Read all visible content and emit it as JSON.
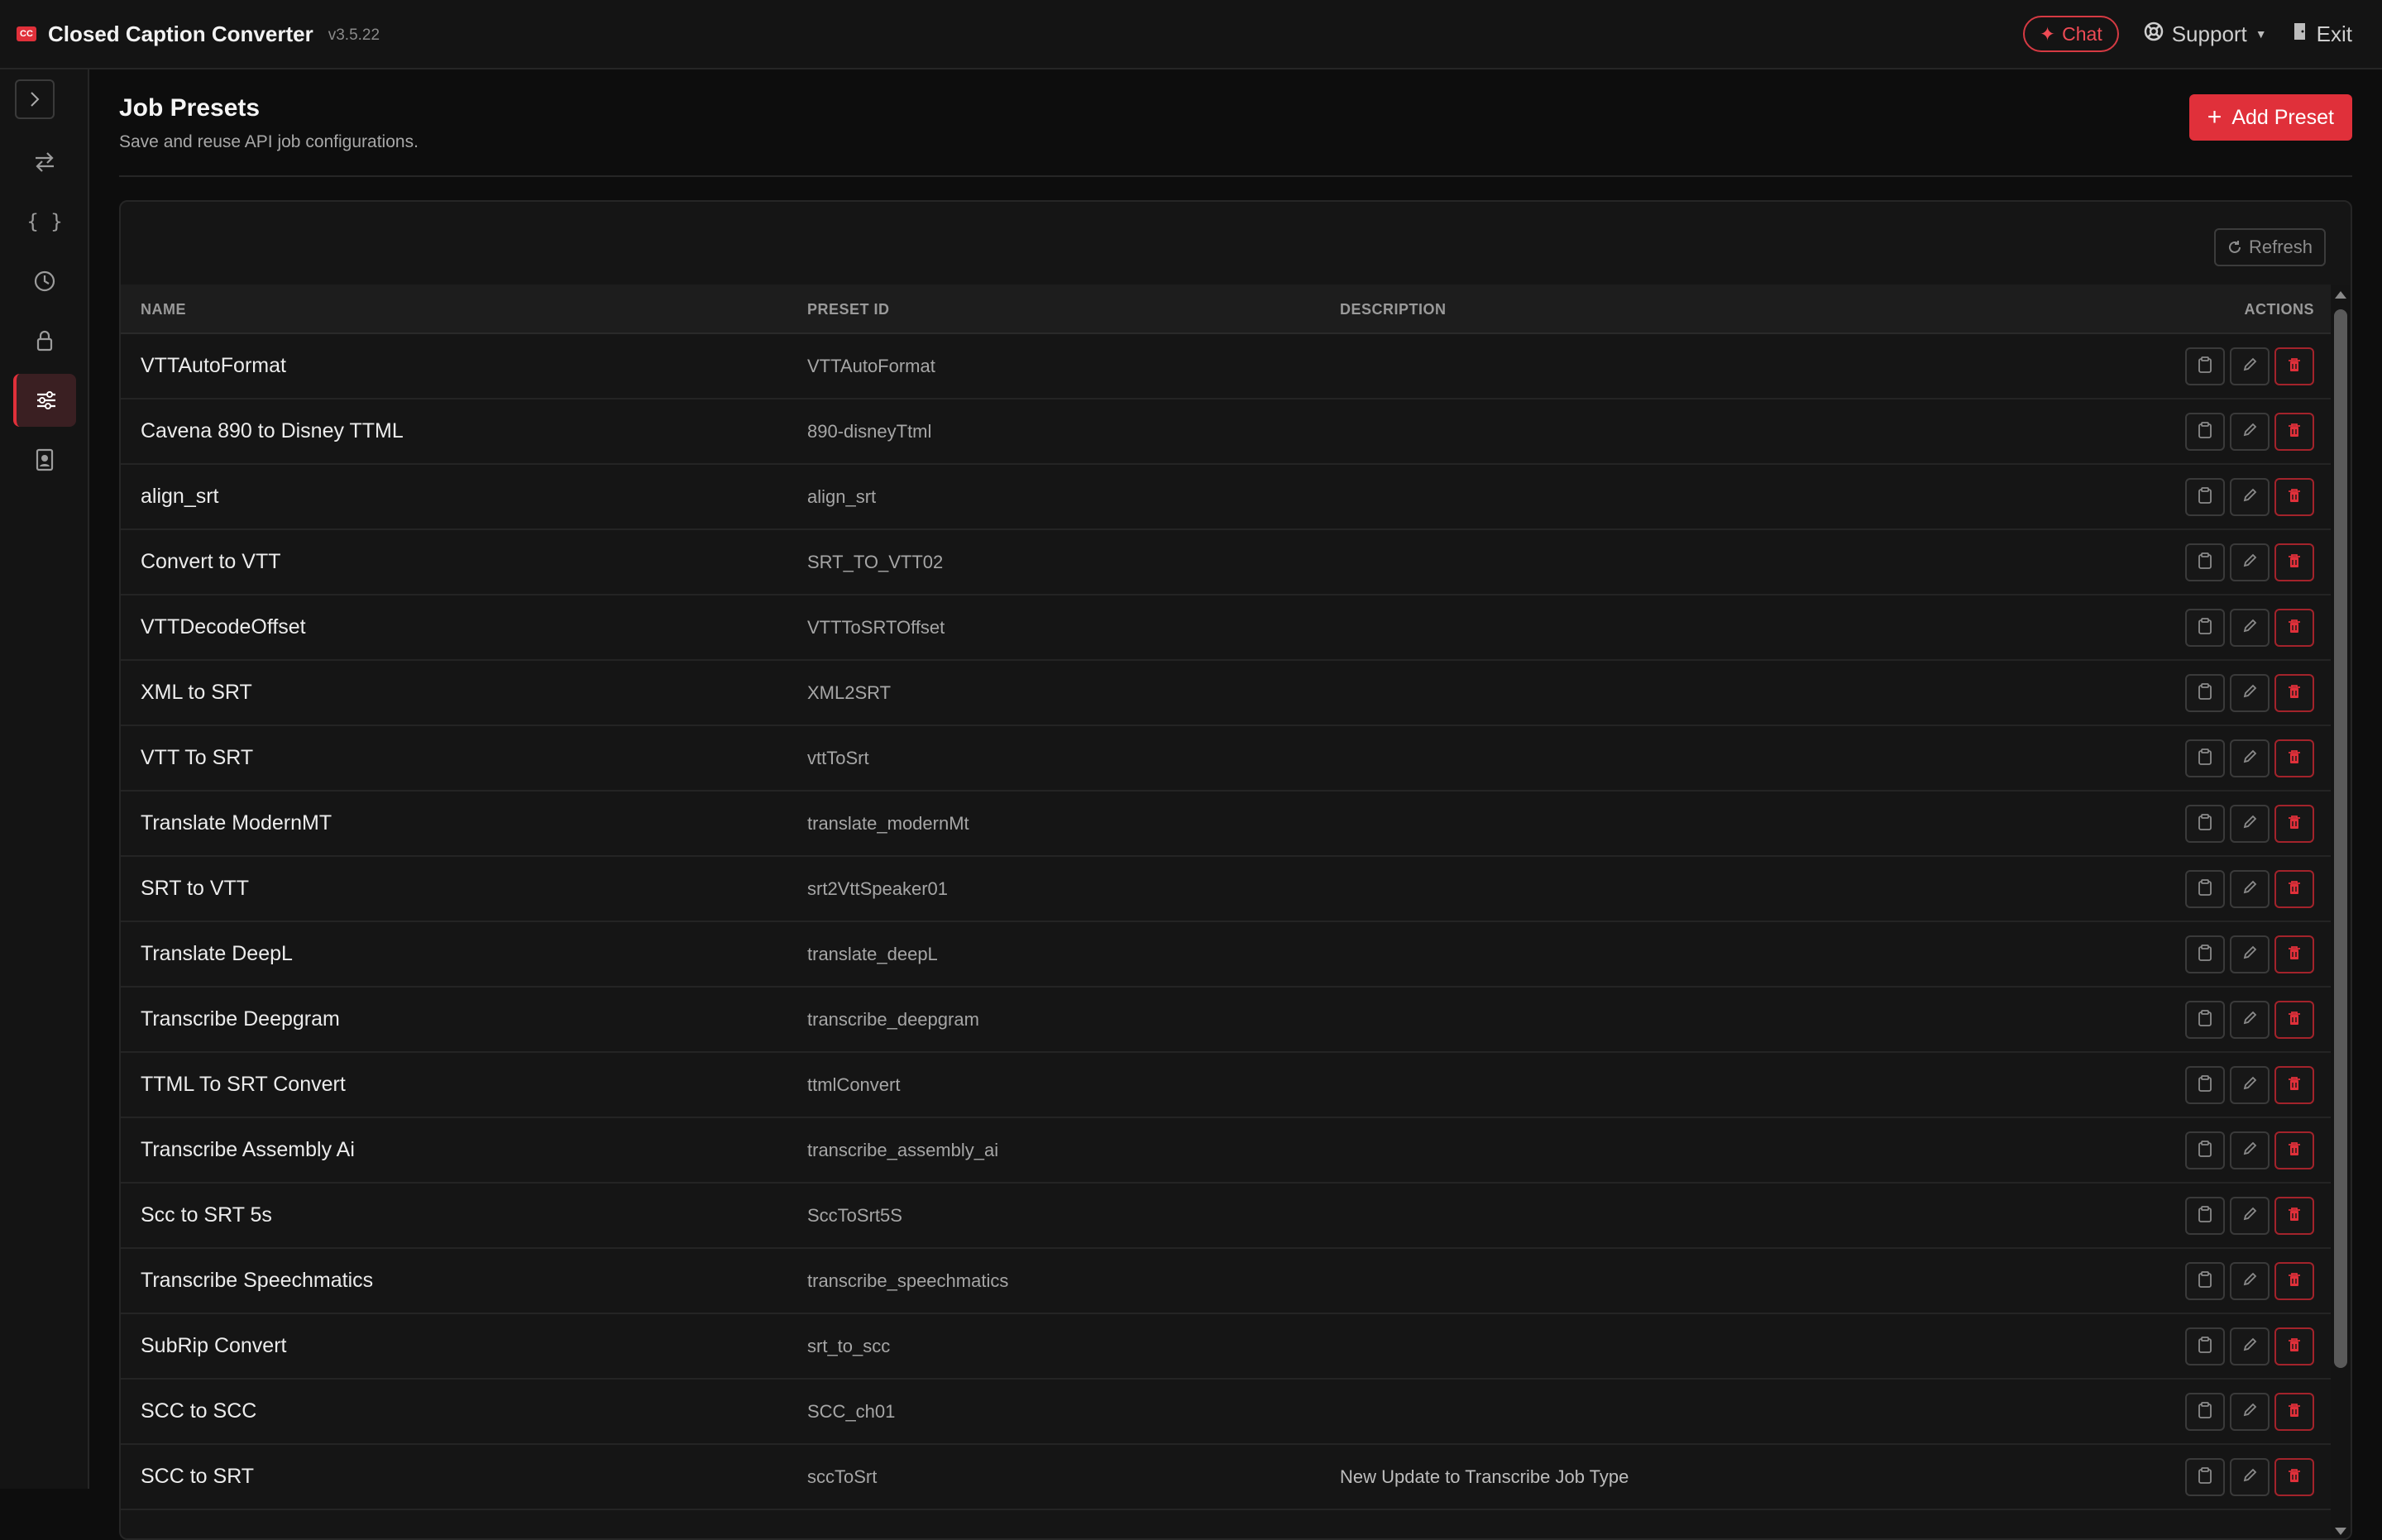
{
  "app": {
    "logo_text": "CC",
    "title": "Closed Caption Converter",
    "version": "v3.5.22",
    "chat_label": "Chat",
    "support_label": "Support",
    "exit_label": "Exit"
  },
  "sidebar": {
    "items": [
      {
        "name": "convert-icon"
      },
      {
        "name": "json-braces-icon"
      },
      {
        "name": "history-clock-icon"
      },
      {
        "name": "lock-icon"
      },
      {
        "name": "presets-sliders-icon",
        "active": true
      },
      {
        "name": "profile-badge-icon"
      }
    ]
  },
  "page": {
    "title": "Job Presets",
    "subtitle": "Save and reuse API job configurations.",
    "add_button": "Add Preset",
    "refresh_button": "Refresh"
  },
  "table": {
    "columns": {
      "name": "NAME",
      "preset_id": "PRESET ID",
      "description": "DESCRIPTION",
      "actions": "ACTIONS"
    },
    "rows": [
      {
        "name": "VTTAutoFormat",
        "id": "VTTAutoFormat",
        "desc": ""
      },
      {
        "name": "Cavena 890 to Disney TTML",
        "id": "890-disneyTtml",
        "desc": ""
      },
      {
        "name": "align_srt",
        "id": "align_srt",
        "desc": ""
      },
      {
        "name": "Convert to VTT",
        "id": "SRT_TO_VTT02",
        "desc": ""
      },
      {
        "name": "VTTDecodeOffset",
        "id": "VTTToSRTOffset",
        "desc": ""
      },
      {
        "name": "XML to SRT",
        "id": "XML2SRT",
        "desc": ""
      },
      {
        "name": "VTT To SRT",
        "id": "vttToSrt",
        "desc": ""
      },
      {
        "name": "Translate ModernMT",
        "id": "translate_modernMt",
        "desc": ""
      },
      {
        "name": "SRT to VTT",
        "id": "srt2VttSpeaker01",
        "desc": ""
      },
      {
        "name": "Translate DeepL",
        "id": "translate_deepL",
        "desc": ""
      },
      {
        "name": "Transcribe Deepgram",
        "id": "transcribe_deepgram",
        "desc": ""
      },
      {
        "name": "TTML To SRT Convert",
        "id": "ttmlConvert",
        "desc": ""
      },
      {
        "name": "Transcribe Assembly Ai",
        "id": "transcribe_assembly_ai",
        "desc": ""
      },
      {
        "name": "Scc to SRT 5s",
        "id": "SccToSrt5S",
        "desc": ""
      },
      {
        "name": "Transcribe Speechmatics",
        "id": "transcribe_speechmatics",
        "desc": ""
      },
      {
        "name": "SubRip Convert",
        "id": "srt_to_scc",
        "desc": ""
      },
      {
        "name": "SCC to SCC",
        "id": "SCC_ch01",
        "desc": ""
      },
      {
        "name": "SCC to SRT",
        "id": "sccToSrt",
        "desc": "New Update to Transcribe Job Type"
      }
    ]
  },
  "colors": {
    "accent": "#e0303a",
    "background": "#0d0d0d",
    "panel": "#151515"
  }
}
